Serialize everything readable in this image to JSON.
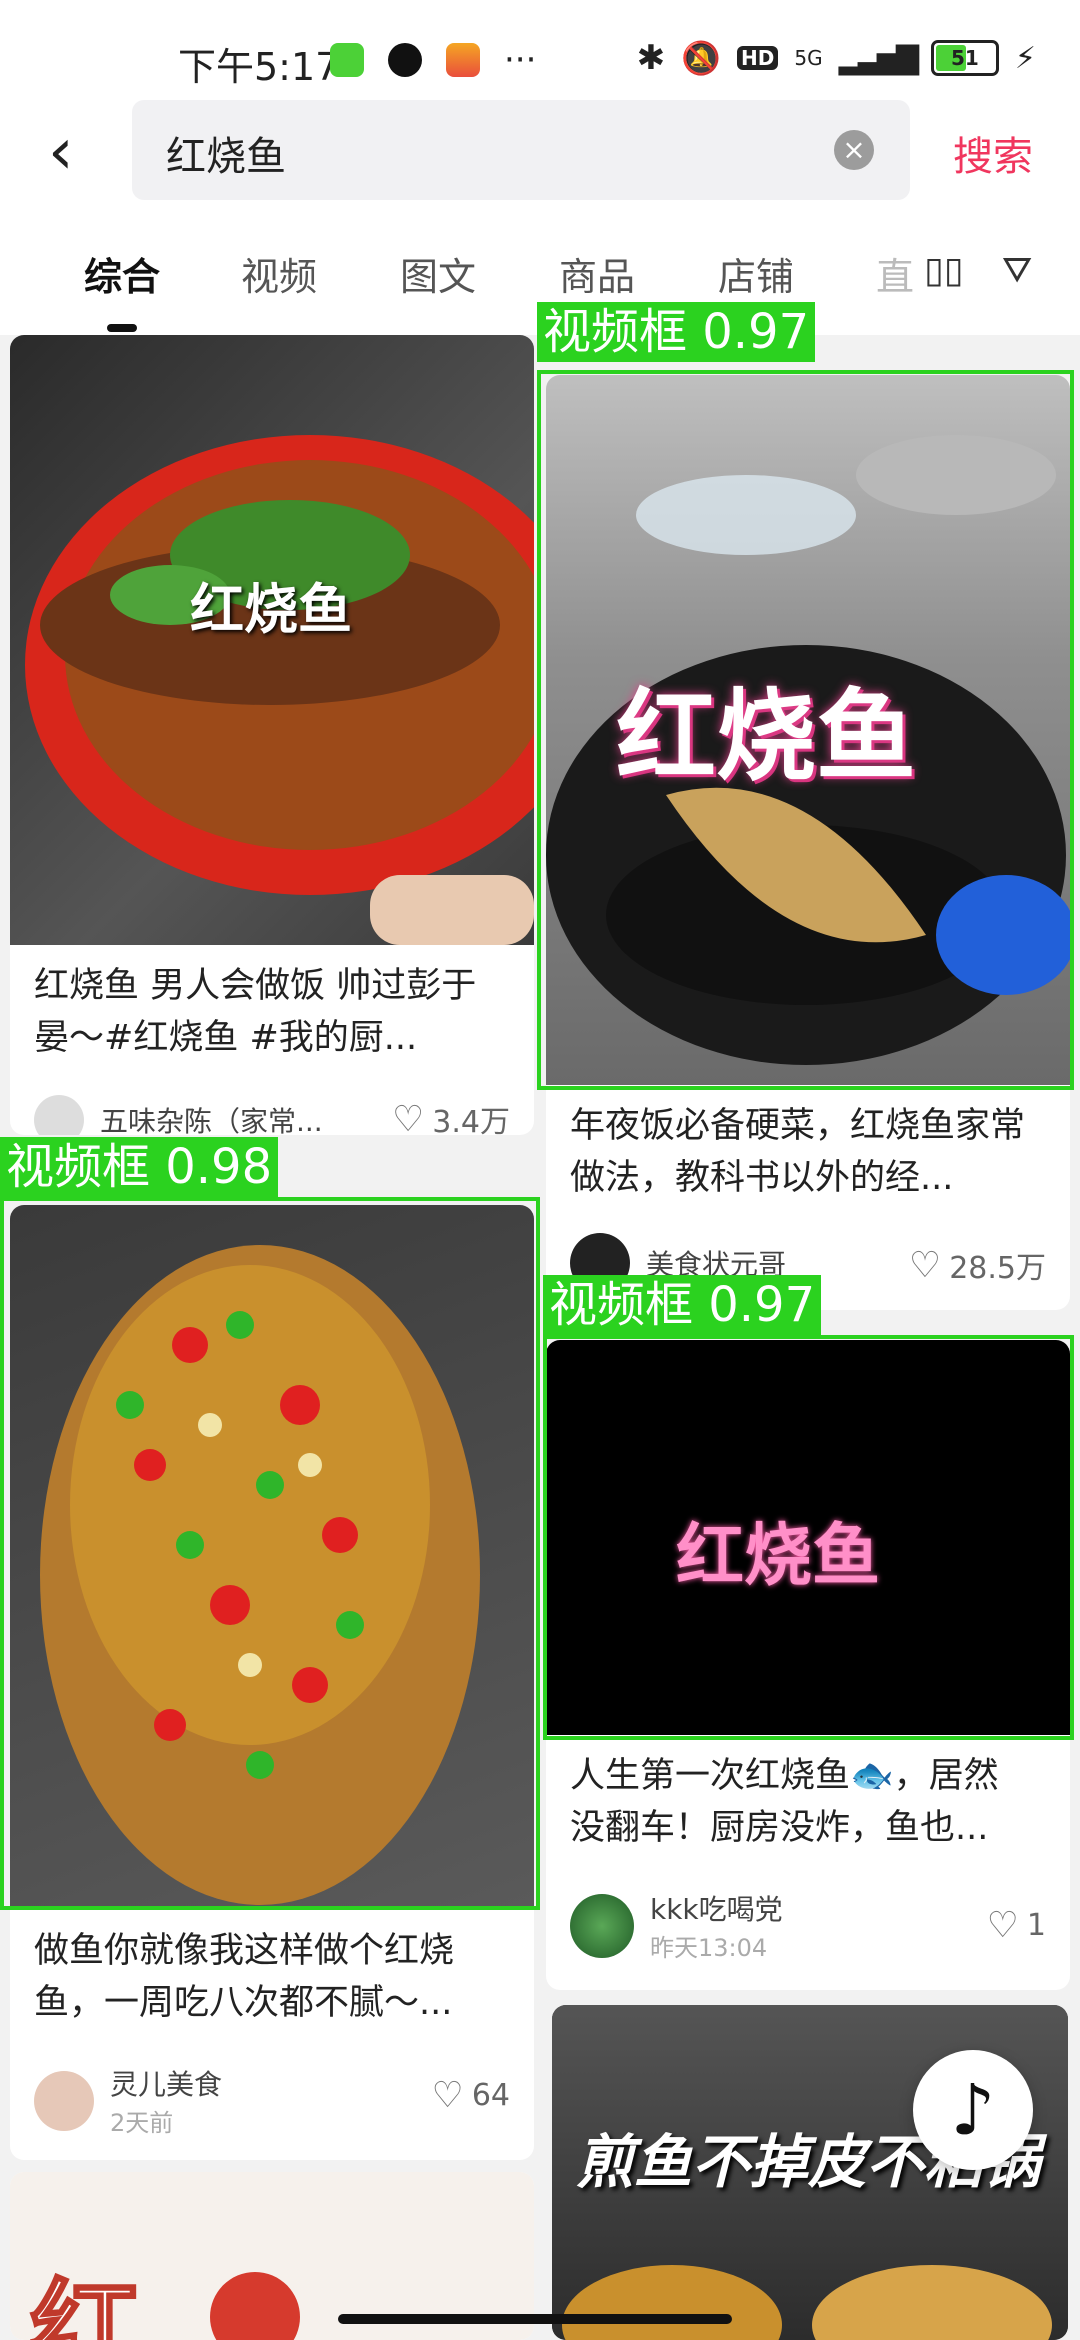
{
  "status_bar": {
    "time": "下午5:17",
    "signal": "5G",
    "hd": "HD",
    "battery": "51",
    "more": "···"
  },
  "search": {
    "query": "红烧鱼",
    "button": "搜索"
  },
  "tabs": [
    "综合",
    "视频",
    "图文",
    "商品",
    "店铺"
  ],
  "tab_more": "直",
  "cards": [
    {
      "overlay": "红烧鱼",
      "title": "红烧鱼 男人会做饭 帅过彭于晏～#红烧鱼 #我的厨...",
      "author": "五味杂陈（家常...",
      "likes": "3.4万"
    },
    {
      "overlay": "红烧鱼",
      "title": "年夜饭必备硬菜，红烧鱼家常做法，教科书以外的经...",
      "author": "美食状元哥",
      "likes": "28.5万"
    },
    {
      "overlay": "",
      "title": "做鱼你就像我这样做个红烧鱼，一周吃八次都不腻～...",
      "author": "灵儿美食",
      "time": "2天前",
      "likes": "64"
    },
    {
      "overlay": "红烧鱼",
      "title": "人生第一次红烧鱼🐟，居然没翻车！厨房没炸，鱼也...",
      "author": "kkk吃喝党",
      "time": "昨天13:04",
      "likes": "1"
    },
    {
      "overlay": "煎鱼不掉皮不粘锅"
    },
    {
      "overlay": "红"
    }
  ],
  "detections": [
    {
      "label": "视频框 0.97"
    },
    {
      "label": "视频框 0.98"
    },
    {
      "label": "视频框 0.97"
    }
  ],
  "colors": {
    "accent": "#f0365e",
    "detection": "#2bd21f"
  }
}
